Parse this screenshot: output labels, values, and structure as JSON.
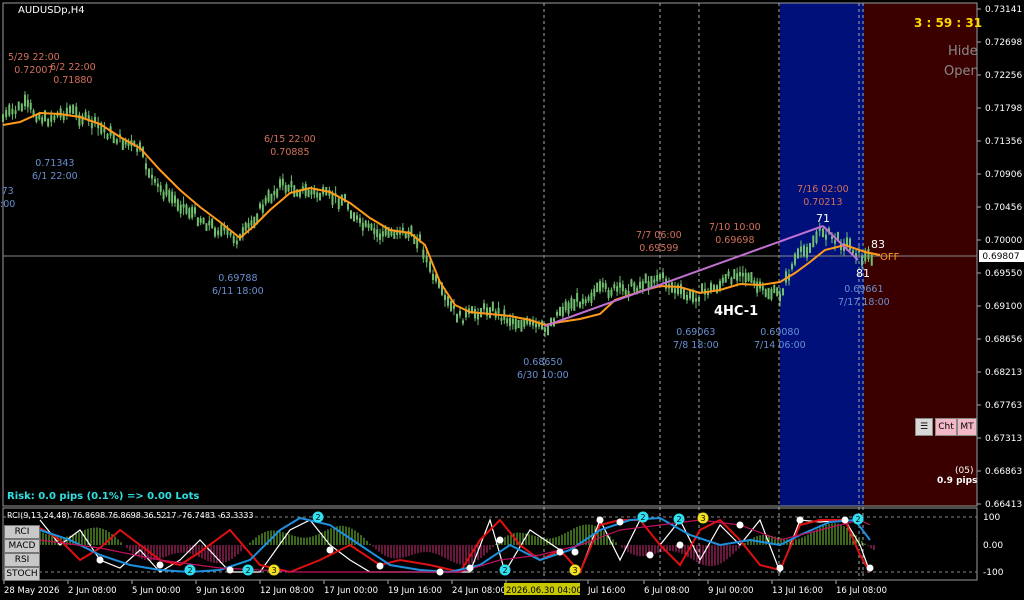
{
  "symbol_title": "AUDUSDp,H4",
  "timer": "3 : 59 : 31",
  "hide_label": "Hide",
  "open_label": "Open",
  "risk_text": "Risk: 0.0 pips (0.1%) => 0.00 Lots",
  "pattern_label": "4HC-1",
  "off_label": "OFF",
  "count_83": "83",
  "count_81": "81",
  "count_71": "71",
  "right_info": {
    "line1": "(05)",
    "line2": "0.9 pips"
  },
  "buttons": {
    "cht": "Cht",
    "mt": "MT"
  },
  "colors": {
    "high_label": "#d2705a",
    "low_label": "#6a8fd0",
    "candle_up": "#6fbf6f",
    "ma_line": "#ff9a1a",
    "pattern_line": "#c070d0",
    "blue_zone": "#00107a",
    "red_zone": "#3a0000"
  },
  "price_axis": [
    "0.73141",
    "0.72698",
    "0.72256",
    "0.71798",
    "0.71356",
    "0.70906",
    "0.70456",
    "0.70000",
    "0.69550",
    "0.69100",
    "0.68656",
    "0.68213",
    "0.67763",
    "0.67313",
    "0.66863",
    "0.66413"
  ],
  "current_price": "0.69807",
  "time_axis": [
    "28 May 2026",
    "2 Jun 08:00",
    "5 Jun 00:00",
    "9 Jun 16:00",
    "12 Jun 08:00",
    "17 Jun 00:00",
    "19 Jun 16:00",
    "24 Jun 08:00",
    "2026.06.30 04:00",
    "Jul 16:00",
    "6 Jul 08:00",
    "9 Jul 00:00",
    "13 Jul 16:00",
    "16 Jul 08:00"
  ],
  "swing_labels": [
    {
      "type": "high",
      "date": "5/29 22:00",
      "price": "0.72007"
    },
    {
      "type": "high",
      "date": "6/2 22:00",
      "price": "0.71880"
    },
    {
      "type": "low",
      "date": "6/1 22:00",
      "price": "0.71343"
    },
    {
      "type": "low",
      "date": ":00",
      "price": "73"
    },
    {
      "type": "high",
      "date": "6/15 22:00",
      "price": "0.70885"
    },
    {
      "type": "low",
      "date": "6/11 18:00",
      "price": "0.69788"
    },
    {
      "type": "low",
      "date": "6/30 10:00",
      "price": "0.68650"
    },
    {
      "type": "high",
      "date": "7/7 06:00",
      "price": "0.69599"
    },
    {
      "type": "high",
      "date": "7/10 10:00",
      "price": "0.69698"
    },
    {
      "type": "low",
      "date": "7/8 18:00",
      "price": "0.69063"
    },
    {
      "type": "low",
      "date": "7/14 06:00",
      "price": "0.69080"
    },
    {
      "type": "high",
      "date": "7/16 02:00",
      "price": "0.70213"
    },
    {
      "type": "low",
      "date": "7/17 18:00",
      "price": "0.69661"
    }
  ],
  "indicator": {
    "header": "RCI(9,13,24,48) 76.8698 76.8698 36.5217 -76.7483 -63.3333",
    "buttons": [
      "RCI",
      "MACD",
      "RSI",
      "STOCH"
    ],
    "axis": [
      "100",
      "0.00",
      "-100"
    ]
  }
}
